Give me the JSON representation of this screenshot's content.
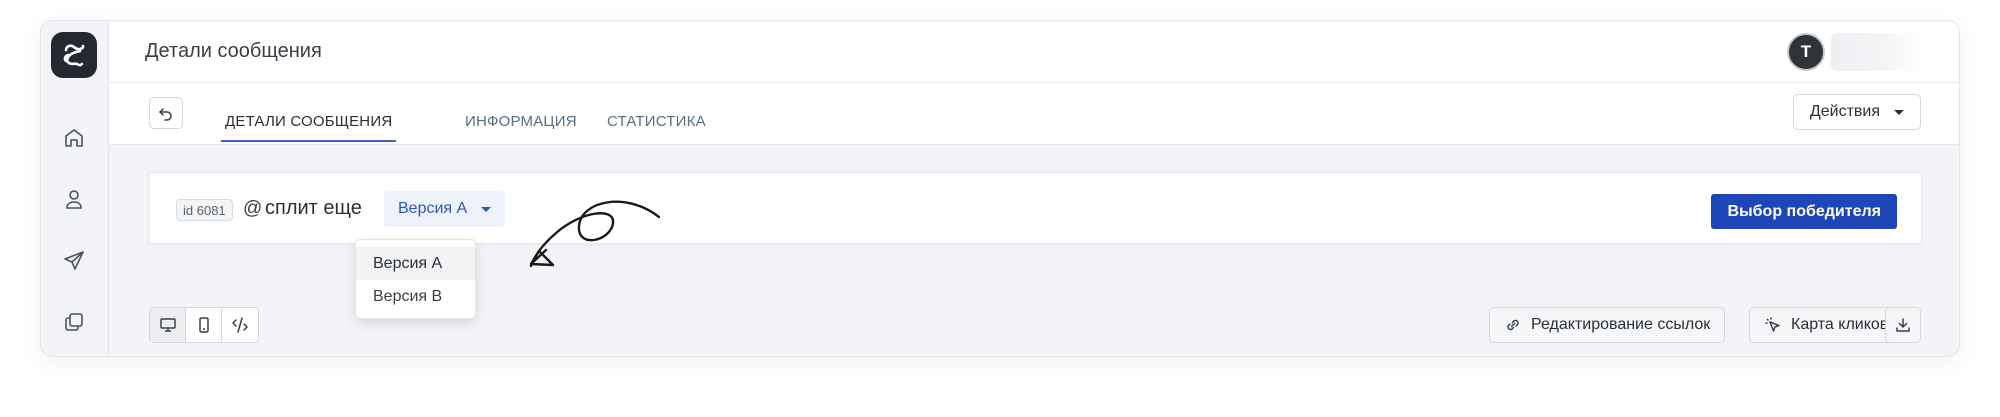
{
  "sidebar": {
    "logo_icon": "brand-logo-icon",
    "items": [
      {
        "icon": "home-icon"
      },
      {
        "icon": "user-icon"
      },
      {
        "icon": "send-icon"
      },
      {
        "icon": "copy-icon"
      }
    ]
  },
  "header": {
    "title": "Детали сообщения",
    "avatar_initial": "T"
  },
  "tabs": {
    "back_icon": "undo-icon",
    "items": [
      {
        "label": "ДЕТАЛИ СООБЩЕНИЯ",
        "active": true
      },
      {
        "label": "ИНФОРМАЦИЯ",
        "active": false
      },
      {
        "label": "СТАТИСТИКА",
        "active": false
      }
    ],
    "actions_label": "Действия"
  },
  "message": {
    "id_badge": "id 6081",
    "name": "сплит еще",
    "version_selected": "Версия A",
    "version_options": [
      "Версия A",
      "Версия B"
    ],
    "winner_button": "Выбор победителя"
  },
  "toolbar": {
    "device_icons": [
      "desktop-icon",
      "mobile-icon",
      "code-icon"
    ],
    "edit_links_label": "Редактирование ссылок",
    "click_map_label": "Карта кликов",
    "download_icon": "download-icon"
  },
  "colors": {
    "accent": "#1f46b8",
    "tab_active_underline": "#3b66c4",
    "select_bg": "#eef2fb",
    "logo_bg": "#232831"
  }
}
